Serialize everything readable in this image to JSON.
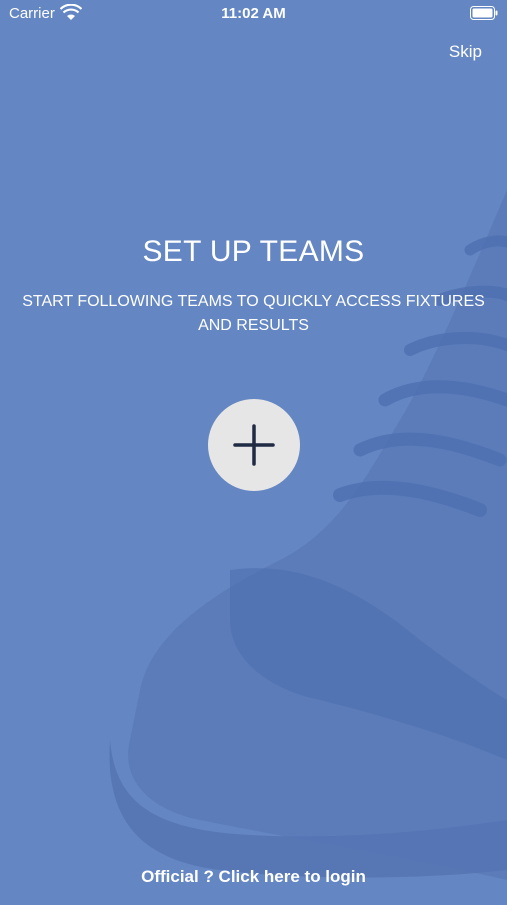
{
  "status_bar": {
    "carrier": "Carrier",
    "time": "11:02 AM"
  },
  "header": {
    "skip_label": "Skip"
  },
  "onboarding": {
    "title": "SET UP TEAMS",
    "subtitle": "START FOLLOWING TEAMS TO QUICKLY ACCESS FIXTURES AND RESULTS",
    "add_button_icon": "plus-icon"
  },
  "footer": {
    "login_label": "Official ? Click here to login"
  },
  "colors": {
    "background": "#6486c2",
    "text": "#ffffff",
    "add_button_bg": "#e6e6e6",
    "plus_icon": "#1f2a44"
  }
}
